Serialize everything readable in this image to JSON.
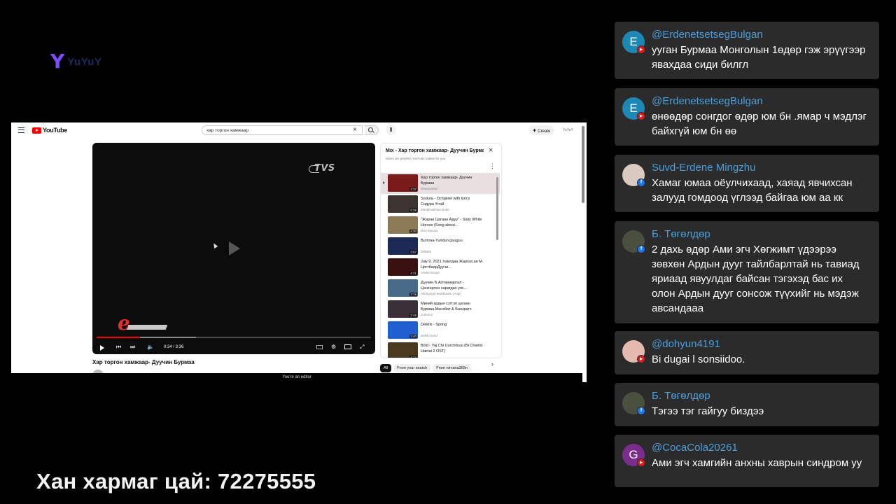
{
  "logo": {
    "mark": "Y",
    "text": "YuYuY"
  },
  "screen": {
    "search_query": "хар торгон хамжаар",
    "yt_logo": "YouTube",
    "create": "Create",
    "account": "YuYuY",
    "tvs_watermark": "TVS",
    "tv_logo": "e",
    "video_time": "0:34 / 3:36",
    "video_progress": 0.157,
    "video_title": "Хар торгон хамжаар- Дуучин Бурмаа",
    "channel": "nirvana365n",
    "editor_notice": "You're an editor",
    "playlist": {
      "title": "Mix - Хар торгон хамжаар- Дуучин Бурмаа",
      "subtitle": "Mixes are playlists YouTube makes for you",
      "items": [
        {
          "title": "Хар торгон хамжаар- Дуучин Бурмаа",
          "channel": "nirvana365n",
          "duration": "3:37",
          "color": "#7a1a1a",
          "active": true
        },
        {
          "title": "Sodura - Ochgerel with lyrics Содура Үггэй",
          "channel": "Munkhsaikhan Bude",
          "duration": "5:28",
          "color": "#3b3430",
          "active": false
        },
        {
          "title": "\"Жаран Цагаан Адуу\" - Sixty White Horses (Song about...",
          "channel": "ska mascaa",
          "duration": "4:30",
          "color": "#8a7a56",
          "active": false
        },
        {
          "title": "Burmaa-Yundun guuguu",
          "channel": "005826",
          "duration": "2:57",
          "color": "#1d2a55",
          "active": false
        },
        {
          "title": "July 9, 2021 Хамтдаа Жаргая,ая М. ЦогтбаярДуучи...",
          "channel": "Ariuka Bongri",
          "duration": "4:21",
          "color": "#3a1010",
          "active": false
        },
        {
          "title": "Дуучин Б.Алтанжаргал - Цэнхэрлэн харагдах улс...",
          "channel": "Altanjargal Buddbadar (Augi)",
          "duration": "3:16",
          "color": "#4a6a8a",
          "active": false
        },
        {
          "title": "Миний ардын сэтгэл цагаан Бурмаа,Мөнхбат & Банзрагч",
          "channel": "sodumur",
          "duration": "2:49",
          "color": "#3b2f3a",
          "active": false
        },
        {
          "title": "Delkhii - Spring",
          "channel": "Delkhi band",
          "duration": "3:40",
          "color": "#1f5fd0",
          "active": false
        },
        {
          "title": "Bold - Yaj Chi Uurchilvuu (Bi Chamd Hairtai 2 OST)",
          "channel": "",
          "duration": "4:14",
          "color": "#4a3a20",
          "active": false
        }
      ]
    },
    "chips": [
      "All",
      "From your search",
      "From nirvana365n"
    ]
  },
  "banner": "Хан хармаг цай: 72275555",
  "chat": [
    {
      "user": "@ErdenetsetsegBulgan",
      "message": "ууган Бурмаа Монголын 1өдөр гэж эрүүгээр явахдаа сиди билгл",
      "avatar_letter": "E",
      "avatar_color": "#1e88b5",
      "platform": "youtube"
    },
    {
      "user": "@ErdenetsetsegBulgan",
      "message": "өнөөдөр сонгдог өдөр юм бн .ямар ч мэдлэг байхгүй юм бн өө",
      "avatar_letter": "E",
      "avatar_color": "#1e88b5",
      "platform": "youtube"
    },
    {
      "user": "Suvd-Erdene Mingzhu",
      "message": "Хамаг юмаа оёулчихаад, хаяад явчихсан залууд гомдоод үглээд байгаа юм аа кк",
      "avatar_letter": "",
      "avatar_color": "#d9c9c0",
      "platform": "facebook"
    },
    {
      "user": "Б. Төгөлдөр",
      "message": "2 дахь өдөр Ами эгч Хөгжимт үдээрээ зөвхөн Ардын дууг тайлбарлтай нь тавиад яриаад явуулдаг байсан тэгэхэд бас их олон Ардын дууг сонсож түүхийг нь мэдэж авсандааа",
      "avatar_letter": "",
      "avatar_color": "#4a5040",
      "platform": "facebook"
    },
    {
      "user": "@dohyun4191",
      "message": "Bi dugai l sonsiidoo.",
      "avatar_letter": "",
      "avatar_color": "#e6b9b0",
      "platform": "youtube"
    },
    {
      "user": "Б. Төгөлдөр",
      "message": "Тэгээ тэг гайгуу биздээ",
      "avatar_letter": "",
      "avatar_color": "#4a5040",
      "platform": "facebook"
    },
    {
      "user": "@CocaCola20261",
      "message": "Ами эгч хамгийн анхны хаврын синдром уу",
      "avatar_letter": "G",
      "avatar_color": "#7b2d8e",
      "platform": "youtube"
    }
  ]
}
